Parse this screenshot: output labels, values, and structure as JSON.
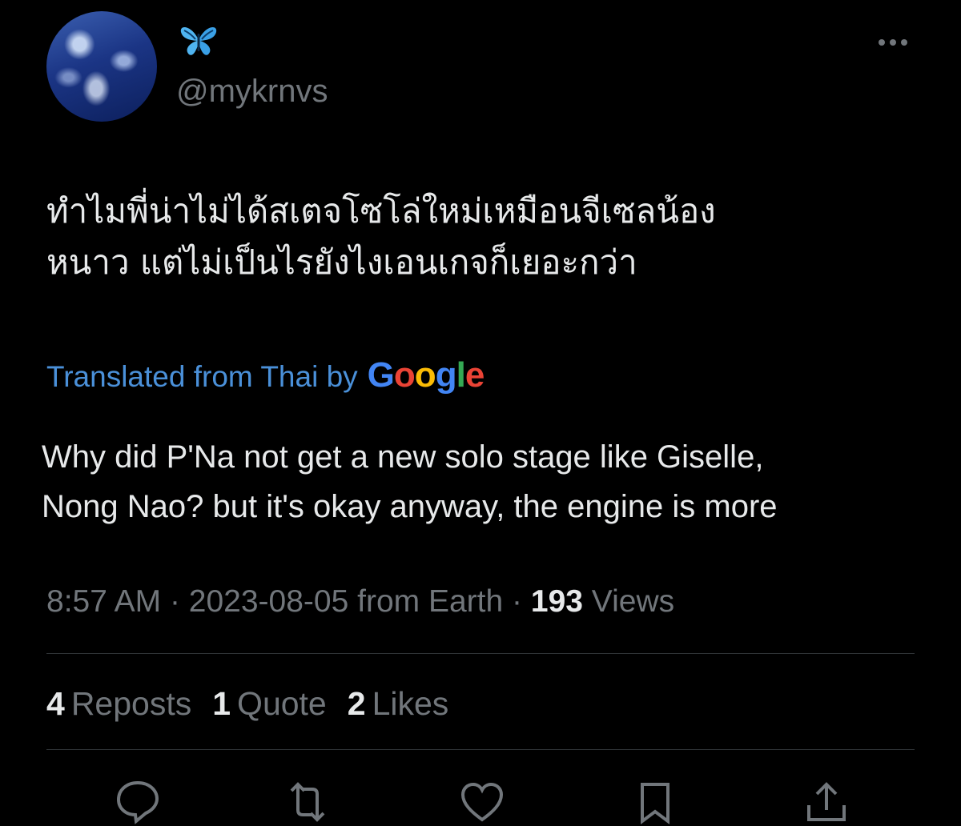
{
  "author": {
    "handle": "@mykrnvs",
    "name_icon": "butterfly-emoji",
    "avatar_icon": "ocean-waves-avatar"
  },
  "menu_icon": "more-horizontal-icon",
  "tweet": {
    "original_text": "ทำไมพี่น่าไม่ได้สเตจโซโล่ใหม่เหมือนจีเซลน้อง\nหนาว แต่ไม่เป็นไรยังไงเอนเกจก็เยอะกว่า",
    "translated_label": "Translated from Thai by",
    "translator": "Google",
    "translated_text": "Why did P'Na not get a new solo stage like Giselle,\nNong Nao? but it's okay anyway, the engine is more"
  },
  "meta": {
    "time": "8:57 AM",
    "separator": "·",
    "date": "2023-08-05",
    "source": "from Earth",
    "views_count": "193",
    "views_label": "Views"
  },
  "stats": {
    "reposts_count": "4",
    "reposts_label": "Reposts",
    "quotes_count": "1",
    "quotes_label": "Quote",
    "likes_count": "2",
    "likes_label": "Likes"
  },
  "actions": [
    "reply-icon",
    "repost-icon",
    "like-icon",
    "bookmark-icon",
    "share-icon"
  ],
  "colors": {
    "background": "#000000",
    "text": "#e7e9ea",
    "secondary": "#71767b",
    "link": "#4a90d9",
    "divider": "#2f3336",
    "google_blue": "#4285F4",
    "google_red": "#EA4335",
    "google_yellow": "#FBBC05",
    "google_green": "#34A853"
  }
}
